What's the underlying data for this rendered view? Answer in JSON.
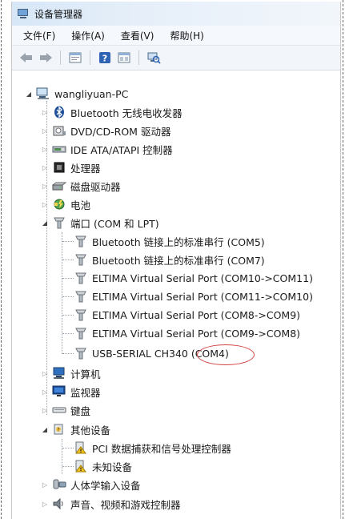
{
  "window": {
    "title": "设备管理器"
  },
  "menubar": {
    "items": [
      "文件(F)",
      "操作(A)",
      "查看(V)",
      "帮助(H)"
    ]
  },
  "toolbar": {
    "buttons": [
      "back-icon",
      "forward-icon",
      "properties-icon",
      "help-icon",
      "view-icon",
      "scan-hardware-icon"
    ]
  },
  "tree": {
    "root": "wangliyuan-PC",
    "categories": [
      {
        "label": "Bluetooth 无线电收发器",
        "icon": "bluetooth-icon",
        "expanded": false
      },
      {
        "label": "DVD/CD-ROM 驱动器",
        "icon": "dvd-drive-icon",
        "expanded": false
      },
      {
        "label": "IDE ATA/ATAPI 控制器",
        "icon": "ide-controller-icon",
        "expanded": false
      },
      {
        "label": "处理器",
        "icon": "processor-icon",
        "expanded": false
      },
      {
        "label": "磁盘驱动器",
        "icon": "disk-drive-icon",
        "expanded": false
      },
      {
        "label": "电池",
        "icon": "battery-icon",
        "expanded": false
      },
      {
        "label": "端口 (COM 和 LPT)",
        "icon": "port-icon",
        "expanded": true
      },
      {
        "label": "计算机",
        "icon": "computer-icon",
        "expanded": false
      },
      {
        "label": "监视器",
        "icon": "monitor-icon",
        "expanded": false
      },
      {
        "label": "键盘",
        "icon": "keyboard-icon",
        "expanded": false
      },
      {
        "label": "其他设备",
        "icon": "other-devices-icon",
        "expanded": true
      },
      {
        "label": "人体学输入设备",
        "icon": "hid-icon",
        "expanded": false
      },
      {
        "label": "声音、视频和游戏控制器",
        "icon": "sound-icon",
        "expanded": false
      }
    ],
    "ports": [
      "Bluetooth 链接上的标准串行 (COM5)",
      "Bluetooth 链接上的标准串行 (COM7)",
      "ELTIMA Virtual Serial Port (COM10->COM11)",
      "ELTIMA Virtual Serial Port (COM11->COM10)",
      "ELTIMA Virtual Serial Port (COM8->COM9)",
      "ELTIMA Virtual Serial Port (COM9->COM8)",
      "USB-SERIAL CH340 (COM4)"
    ],
    "other_devices": [
      "PCI 数据捕获和信号处理控制器",
      "未知设备"
    ]
  },
  "colors": {
    "title_gradient_start": "#d7e7f7",
    "annotation_ellipse": "#d34545"
  }
}
